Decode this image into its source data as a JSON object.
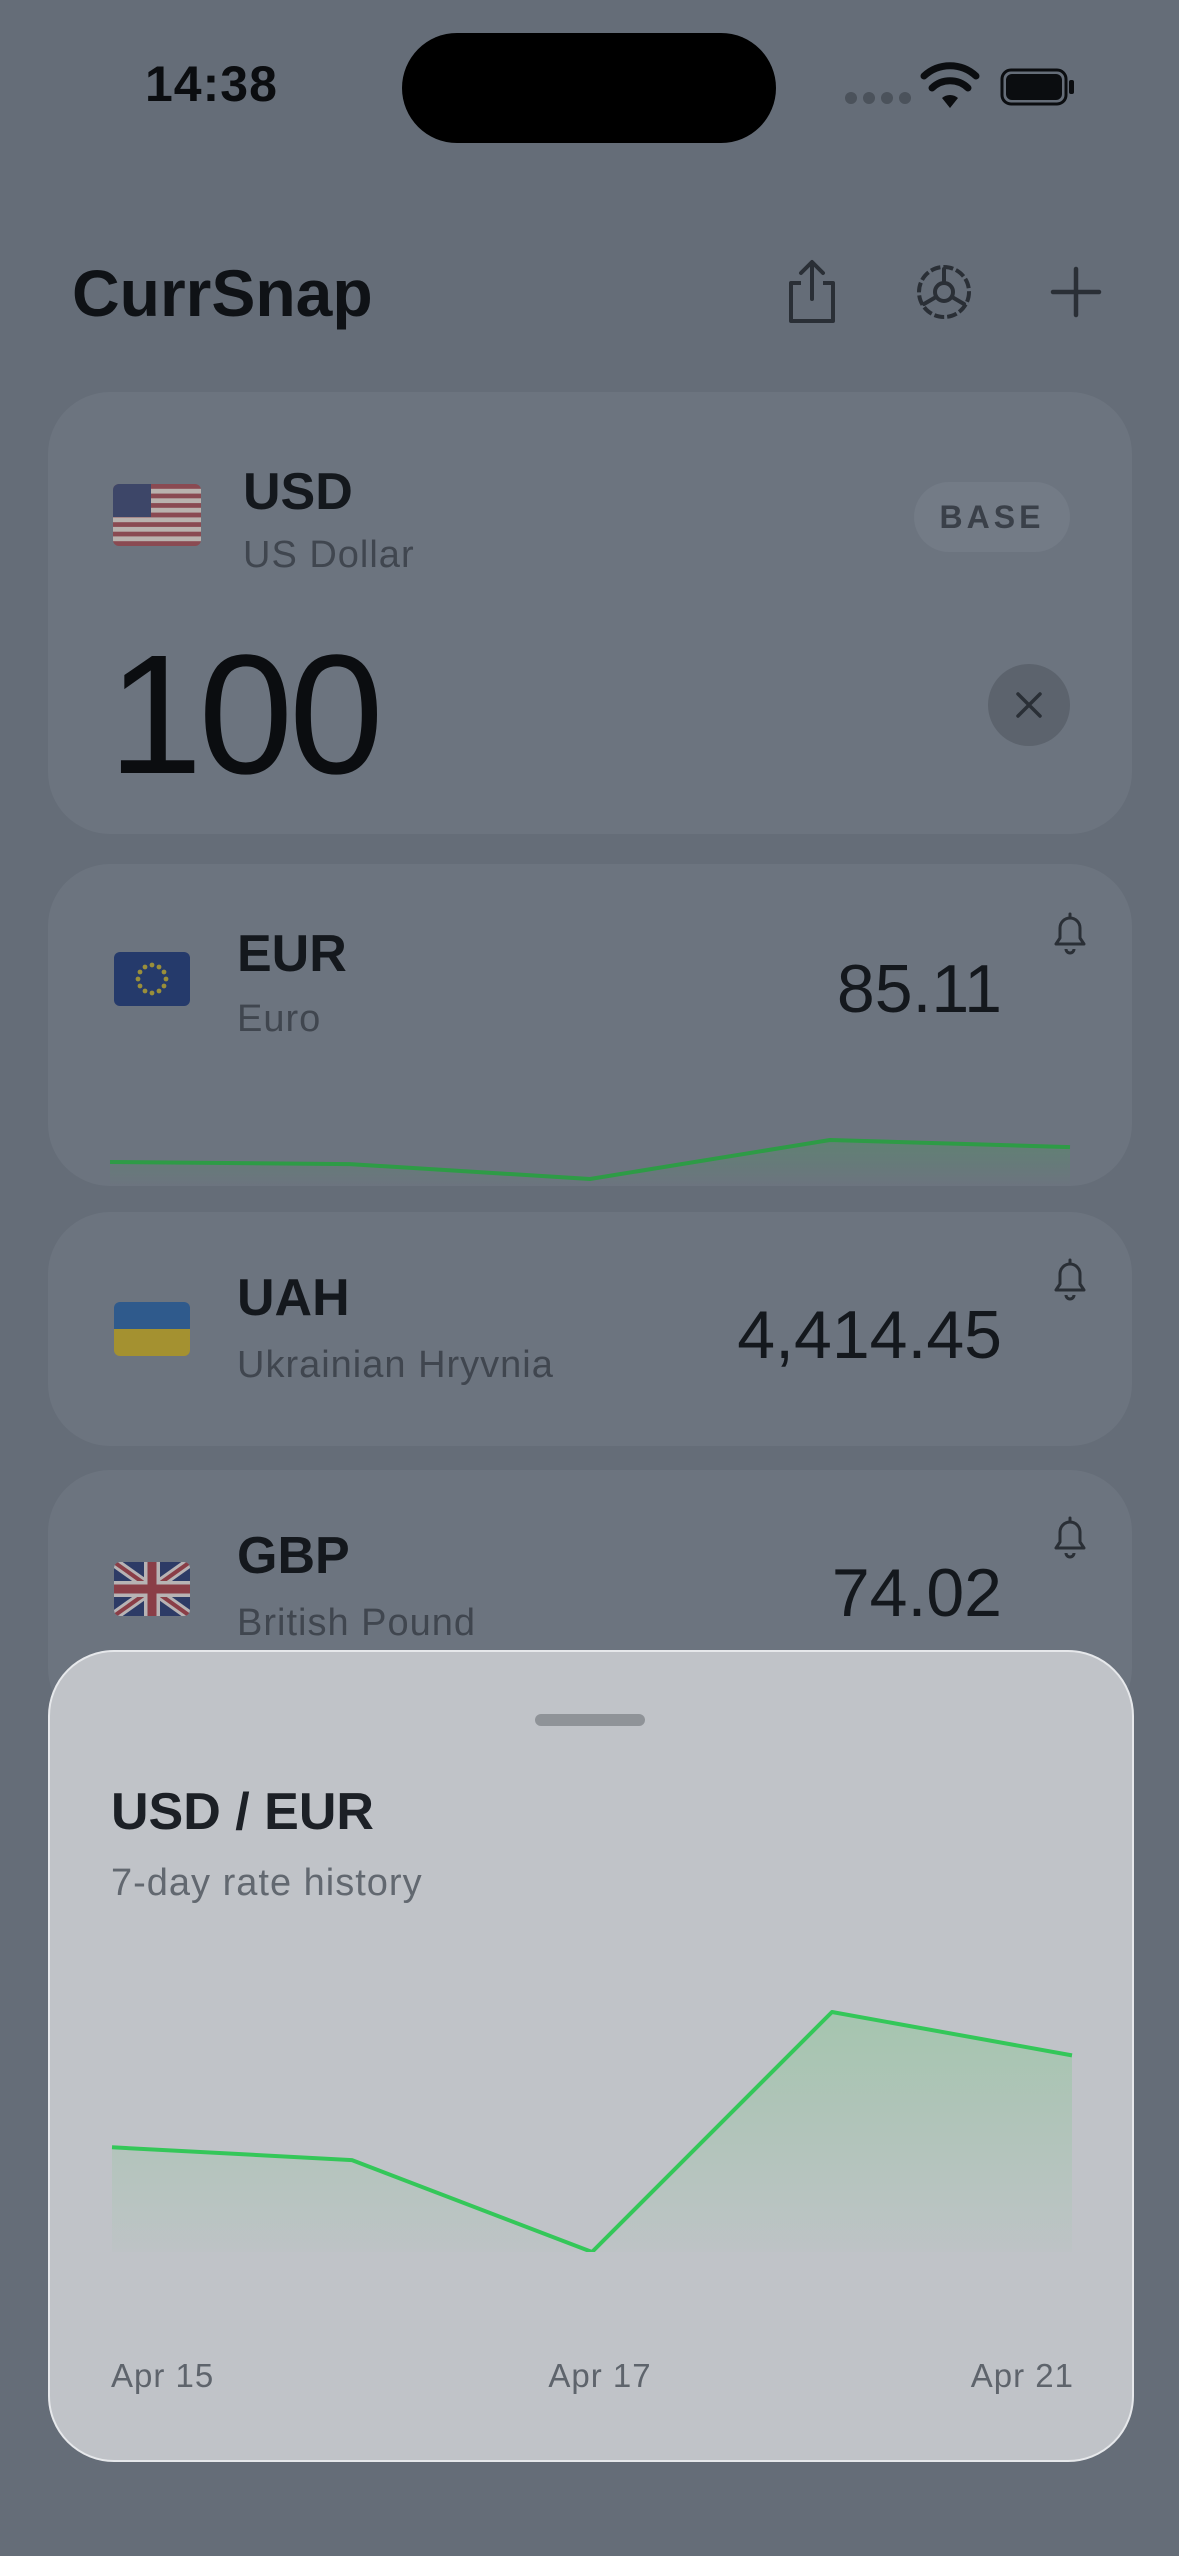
{
  "status_bar": {
    "time": "14:38"
  },
  "header": {
    "title": "CurrSnap"
  },
  "base": {
    "code": "USD",
    "name": "US Dollar",
    "badge": "BASE",
    "amount": "100"
  },
  "rows": [
    {
      "code": "EUR",
      "name": "Euro",
      "value": "85.11"
    },
    {
      "code": "UAH",
      "name": "Ukrainian Hryvnia",
      "value": "4,414.45"
    },
    {
      "code": "GBP",
      "name": "British Pound",
      "value": "74.02"
    }
  ],
  "sheet": {
    "title": "USD / EUR",
    "subtitle": "7-day rate history"
  },
  "chart_data": {
    "type": "area",
    "x_ticks": [
      "Apr 15",
      "Apr 17",
      "Apr 21"
    ],
    "values": [
      0.8525,
      0.852,
      0.8484,
      0.8578,
      0.8561
    ],
    "line_color": "#34c759"
  },
  "colors": {
    "positive": "#2e9b46",
    "background_dim": "#656d78"
  }
}
